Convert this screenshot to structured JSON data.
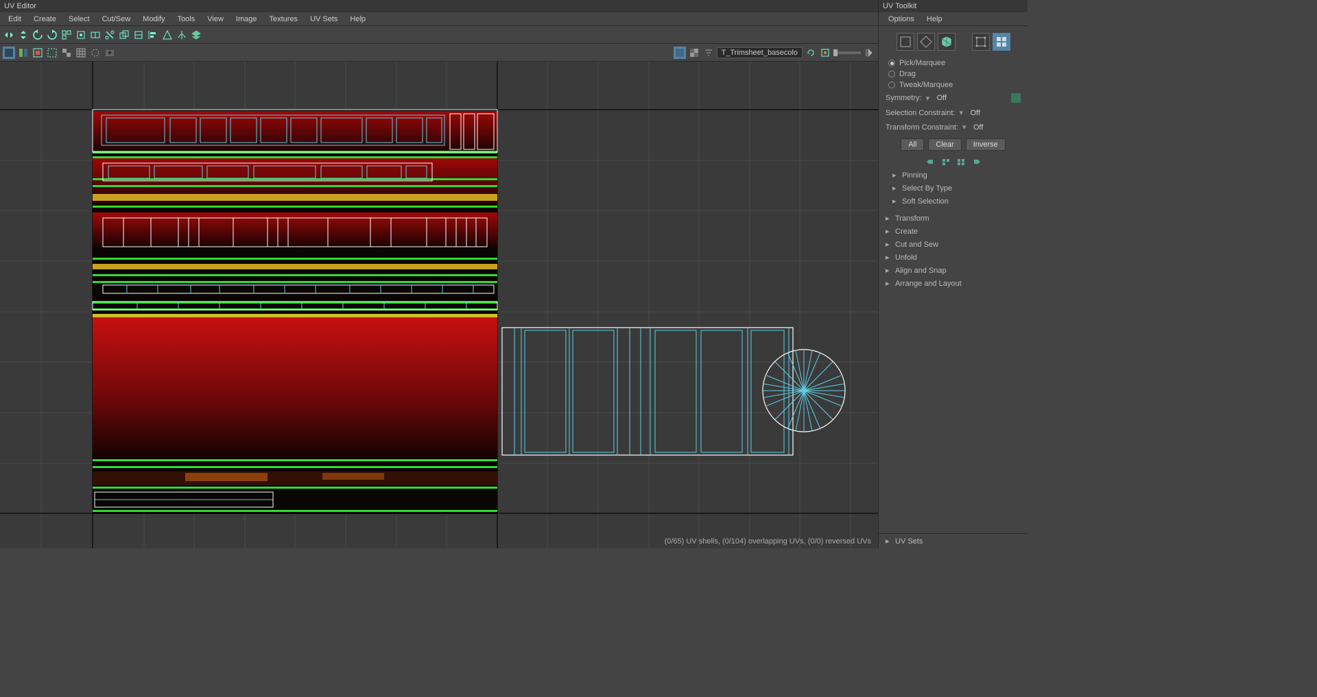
{
  "editor": {
    "title": "UV Editor",
    "menu": [
      "Edit",
      "Create",
      "Select",
      "Cut/Sew",
      "Modify",
      "Tools",
      "View",
      "Image",
      "Textures",
      "UV Sets",
      "Help"
    ],
    "texture_name": "T_Trimsheet_basecolo",
    "status": "(0/65) UV shells, (0/104) overlapping UVs, (0/0) reversed UVs"
  },
  "toolkit": {
    "title": "UV Toolkit",
    "menu": [
      "Options",
      "Help"
    ],
    "selection_modes": {
      "pick": "Pick/Marquee",
      "drag": "Drag",
      "tweak": "Tweak/Marquee"
    },
    "symmetry": {
      "label": "Symmetry:",
      "value": "Off"
    },
    "sel_constraint": {
      "label": "Selection Constraint:",
      "value": "Off"
    },
    "trans_constraint": {
      "label": "Transform Constraint:",
      "value": "Off"
    },
    "buttons": {
      "all": "All",
      "clear": "Clear",
      "inverse": "Inverse"
    },
    "sections": {
      "pinning": "Pinning",
      "select_by_type": "Select By Type",
      "soft_selection": "Soft Selection",
      "transform": "Transform",
      "create": "Create",
      "cut_sew": "Cut and Sew",
      "unfold": "Unfold",
      "align_snap": "Align and Snap",
      "arrange_layout": "Arrange and Layout"
    },
    "footer": "UV Sets"
  }
}
